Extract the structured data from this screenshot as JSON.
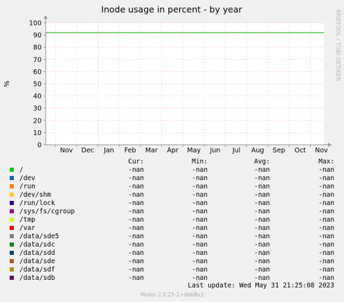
{
  "chart_data": {
    "type": "line",
    "title": "Inode usage in percent - by year",
    "ylabel": "%",
    "side_text": "RRDTOOL / TOBI OETIKER",
    "ylim": [
      0,
      100
    ],
    "yticks": [
      0,
      10,
      20,
      30,
      40,
      50,
      60,
      70,
      80,
      90,
      100
    ],
    "x_tick_labels": [
      "Nov",
      "Dec",
      "Jan",
      "Feb",
      "Mar",
      "Apr",
      "May",
      "Jun",
      "Jul",
      "Aug",
      "Sep",
      "Oct",
      "Nov"
    ],
    "grid": true,
    "warning_line": {
      "value": 92,
      "color": "#00aa00"
    },
    "series": [
      {
        "name": "/",
        "color": "#00cc00",
        "cur": "-nan",
        "min": "-nan",
        "avg": "-nan",
        "max": "-nan"
      },
      {
        "name": "/dev",
        "color": "#0066b3",
        "cur": "-nan",
        "min": "-nan",
        "avg": "-nan",
        "max": "-nan"
      },
      {
        "name": "/run",
        "color": "#ff8000",
        "cur": "-nan",
        "min": "-nan",
        "avg": "-nan",
        "max": "-nan"
      },
      {
        "name": "/dev/shm",
        "color": "#ffcc00",
        "cur": "-nan",
        "min": "-nan",
        "avg": "-nan",
        "max": "-nan"
      },
      {
        "name": "/run/lock",
        "color": "#330099",
        "cur": "-nan",
        "min": "-nan",
        "avg": "-nan",
        "max": "-nan"
      },
      {
        "name": "/sys/fs/cgroup",
        "color": "#990099",
        "cur": "-nan",
        "min": "-nan",
        "avg": "-nan",
        "max": "-nan"
      },
      {
        "name": "/tmp",
        "color": "#ccff00",
        "cur": "-nan",
        "min": "-nan",
        "avg": "-nan",
        "max": "-nan"
      },
      {
        "name": "/var",
        "color": "#ff0000",
        "cur": "-nan",
        "min": "-nan",
        "avg": "-nan",
        "max": "-nan"
      },
      {
        "name": "/data/sde5",
        "color": "#808080",
        "cur": "-nan",
        "min": "-nan",
        "avg": "-nan",
        "max": "-nan"
      },
      {
        "name": "/data/sdc",
        "color": "#008f00",
        "cur": "-nan",
        "min": "-nan",
        "avg": "-nan",
        "max": "-nan"
      },
      {
        "name": "/data/sdd",
        "color": "#00487d",
        "cur": "-nan",
        "min": "-nan",
        "avg": "-nan",
        "max": "-nan"
      },
      {
        "name": "/data/sde",
        "color": "#b35a00",
        "cur": "-nan",
        "min": "-nan",
        "avg": "-nan",
        "max": "-nan"
      },
      {
        "name": "/data/sdf",
        "color": "#b38f00",
        "cur": "-nan",
        "min": "-nan",
        "avg": "-nan",
        "max": "-nan"
      },
      {
        "name": "/data/sdb",
        "color": "#6b006b",
        "cur": "-nan",
        "min": "-nan",
        "avg": "-nan",
        "max": "-nan"
      }
    ]
  },
  "legend_headers": {
    "cur": "Cur:",
    "min": "Min:",
    "avg": "Avg:",
    "max": "Max:"
  },
  "last_update": "Last update:  Wed May 31 21:25:08 2023",
  "munin_version": "Munin 2.0.25-1+deb8u3"
}
